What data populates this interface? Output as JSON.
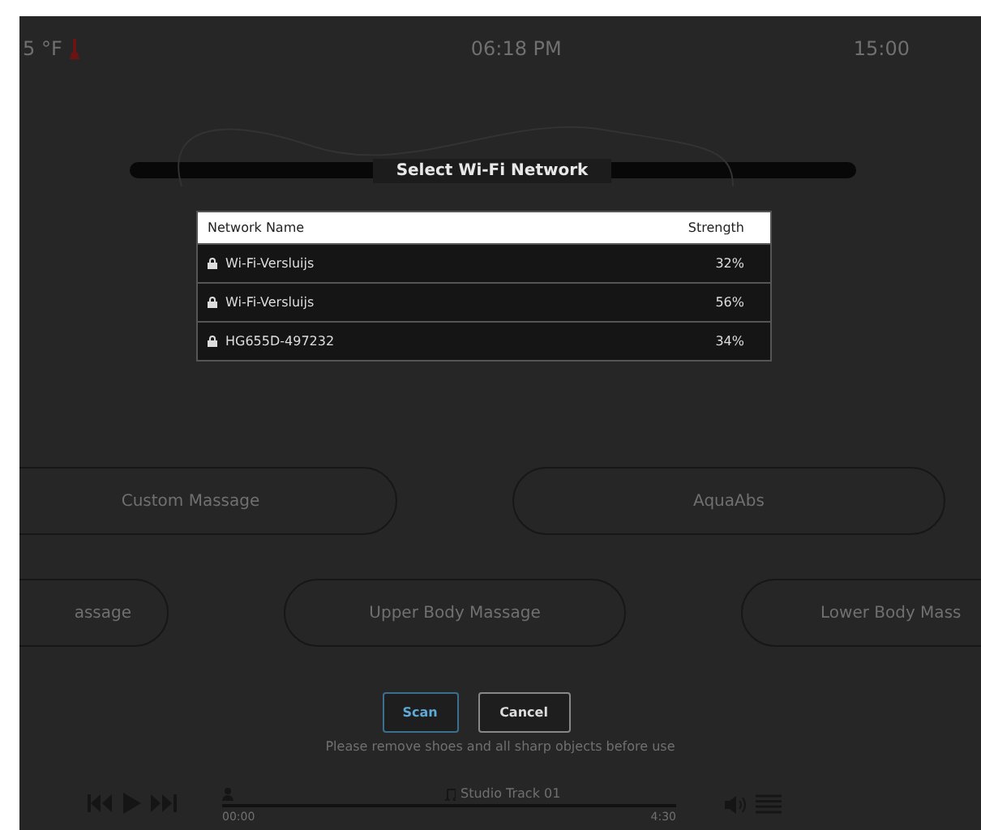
{
  "status_bar": {
    "temperature": "5 °F",
    "clock": "06:18 PM",
    "timer": "15:00"
  },
  "dialog": {
    "title": "Select Wi-Fi Network",
    "columns": [
      "Network Name",
      "Strength"
    ],
    "networks": [
      {
        "name": "Wi-Fi-Versluijs",
        "strength": "32%",
        "locked": true
      },
      {
        "name": "Wi-Fi-Versluijs",
        "strength": "56%",
        "locked": true
      },
      {
        "name": "HG655D-497232",
        "strength": "34%",
        "locked": true
      }
    ],
    "buttons": [
      {
        "label": "Scan",
        "kind": "primary"
      },
      {
        "label": "Cancel",
        "kind": "secondary"
      }
    ]
  },
  "massage_rows": [
    [
      "Custom Massage",
      "AquaAbs"
    ],
    [
      "assage",
      "Upper Body Massage",
      "Lower Body Mass"
    ]
  ],
  "notice": "Please remove shoes and all sharp objects before use",
  "player": {
    "track": "Studio Track 01",
    "elapsed": "00:00",
    "total": "4:30",
    "level": 0
  }
}
